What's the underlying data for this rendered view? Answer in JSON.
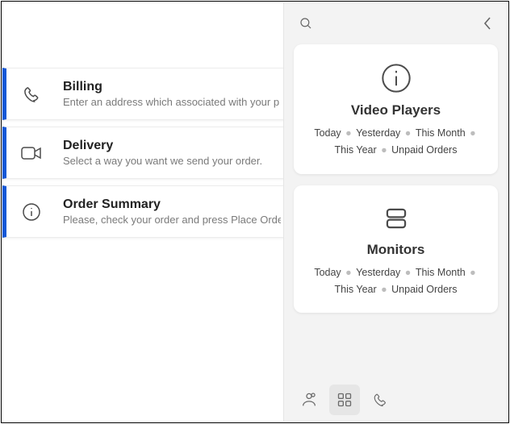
{
  "steps": [
    {
      "icon": "phone-icon",
      "title": "Billing",
      "desc": "Enter an address which associated with your p"
    },
    {
      "icon": "camera-icon",
      "title": "Delivery",
      "desc": "Select a way you want we send your order."
    },
    {
      "icon": "info-icon",
      "title": "Order Summary",
      "desc": "Please, check your order and press Place Orde"
    }
  ],
  "panel": {
    "cards": [
      {
        "icon": "info-icon",
        "title": "Video Players",
        "filters": [
          "Today",
          "Yesterday",
          "This Month",
          "This Year",
          "Unpaid Orders"
        ]
      },
      {
        "icon": "monitor-icon",
        "title": "Monitors",
        "filters": [
          "Today",
          "Yesterday",
          "This Month",
          "This Year",
          "Unpaid Orders"
        ]
      }
    ],
    "footer_icons": [
      "person-icon",
      "grid-icon",
      "phone-icon"
    ],
    "footer_active_index": 1
  }
}
